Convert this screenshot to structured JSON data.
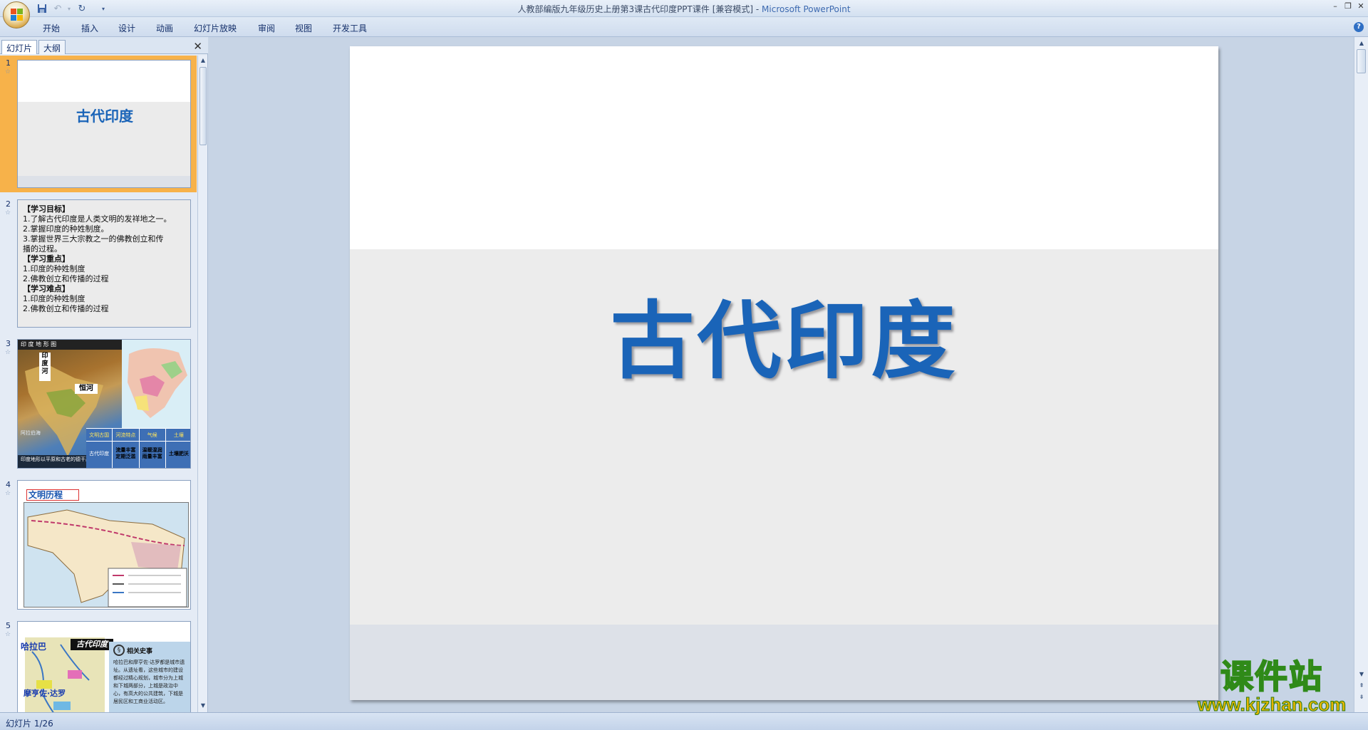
{
  "window": {
    "title": "人教部编版九年级历史上册第3课古代印度PPT课件 [兼容模式]",
    "app_name": "Microsoft PowerPoint",
    "minimize": "–",
    "restore": "❐",
    "close": "✕"
  },
  "ribbon": {
    "tabs": [
      "开始",
      "插入",
      "设计",
      "动画",
      "幻灯片放映",
      "审阅",
      "视图",
      "开发工具"
    ],
    "help": "?"
  },
  "panel": {
    "tab_slides": "幻灯片",
    "tab_outline": "大纲",
    "close": "✕"
  },
  "thumbs": [
    {
      "num": "1",
      "title": "古代印度"
    },
    {
      "num": "2",
      "lines": [
        "【学习目标】",
        "1.了解古代印度是人类文明的发祥地之一。",
        "2.掌握印度的种姓制度。",
        "3.掌握世界三大宗教之一的佛教创立和传",
        "播的过程。",
        "【学习重点】",
        "1.印度的种姓制度",
        "2.佛教创立和传播的过程",
        "【学习难点】",
        "1.印度的种姓制度",
        "2.佛教创立和传播的过程"
      ]
    },
    {
      "num": "3",
      "map_header": "印 度 地 形 图",
      "label_a": "印度河",
      "label_b": "恒河",
      "sea": "阿拉伯海",
      "caption": "印度地形以平原和古老的德干高原",
      "table_head": [
        "文明古国",
        "河流特点",
        "气候",
        "土壤"
      ],
      "table_row": [
        "古代印度",
        "流量丰富 定期泛滥",
        "温暖湿润 雨量丰富",
        "土壤肥沃"
      ]
    },
    {
      "num": "4",
      "heading": "文明历程"
    },
    {
      "num": "5",
      "label_a": "哈拉巴",
      "title": "古代印度",
      "label_b": "摩亨佐·达罗",
      "box_title": "相关史事",
      "box_text": "哈拉巴和摩亨佐·达罗都是城市遗址。从遗址看，这些城市的建设都经过精心规划，城市分为上城和下城两部分，上城是政治中心，有高大的公共建筑，下城是居民区和工商业活动区。"
    }
  ],
  "slide": {
    "title": "古代印度"
  },
  "status": {
    "slide_info": "幻灯片 1/26"
  },
  "watermark": {
    "cn": "课件站",
    "url": "www.kjzhan.com"
  }
}
